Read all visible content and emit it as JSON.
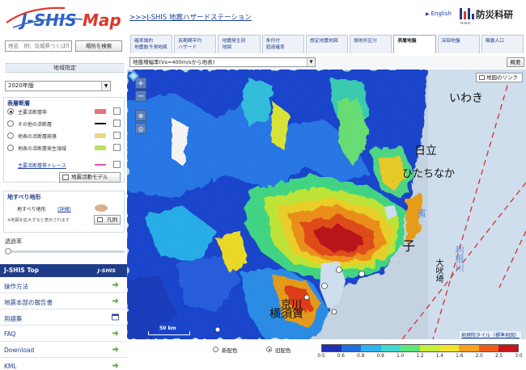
{
  "header": {
    "app_title": "J-SHIS Map",
    "top_link": ">>>J-SHIS 地震ハザードステーション",
    "lang_link": "English",
    "org_name": "防災科研",
    "org_abbr": "NIED"
  },
  "search": {
    "placeholder": "地名　例：茨城県つくば市",
    "button_label": "場所を検索"
  },
  "region": {
    "heading": "地域指定",
    "year_selected": "2020年版"
  },
  "faults": {
    "title": "表層断層",
    "rows": [
      {
        "label": "主要活断層帯",
        "color": "#e8707a",
        "selected": true
      },
      {
        "label": "その他の活断層",
        "color": "#111111",
        "selected": false
      },
      {
        "label": "地表の活断層崩落",
        "color": "#e8d98a",
        "selected": false
      },
      {
        "label": "地表の活断層発生領域",
        "color": "#b7e35c",
        "selected": false
      }
    ],
    "trace_link": "主要活断層帯トレース",
    "trace_color": "#e64fb3",
    "model_button": "地震活動モデル"
  },
  "landslide": {
    "title": "地すべり地形",
    "row_label": "地すべり地形",
    "detail_link": "(詳細)",
    "note": "※地図を拡大すると表示されます",
    "legend_button": "凡例"
  },
  "opacity": {
    "label": "透過率",
    "value_percent": 0
  },
  "top_menu": {
    "title": "J-SHIS Top",
    "mini_logo": "J-SHIS",
    "items": [
      {
        "label": "操作方法",
        "icon": "arrow-right-icon"
      },
      {
        "label": "地震本部の報告書",
        "icon": "arrow-right-icon"
      },
      {
        "label": "用語集",
        "icon": "window-icon"
      },
      {
        "label": "FAQ",
        "icon": "arrow-right-icon"
      },
      {
        "label": "Download",
        "icon": "arrow-right-icon"
      },
      {
        "label": "KML",
        "icon": "arrow-right-icon"
      }
    ]
  },
  "tabs": [
    {
      "label": "確率論的\n地震動予測地図",
      "active": false
    },
    {
      "label": "長期間平均\nハザード",
      "active": false
    },
    {
      "label": "地震発生別\n地図",
      "active": false
    },
    {
      "label": "条件付\n超過確率",
      "active": false
    },
    {
      "label": "想定地震地図",
      "active": false
    },
    {
      "label": "微地形区分",
      "active": false
    },
    {
      "label": "表層地盤",
      "active": true
    },
    {
      "label": "深部地盤",
      "active": false
    },
    {
      "label": "曝露人口",
      "active": false
    }
  ],
  "toolbar": {
    "layer_selected": "地盤増幅率(Vs=400m/sから地表)",
    "summary_button": "概要"
  },
  "map": {
    "link_button": "地図のリンク",
    "zoom_in": "+",
    "zoom_out": "−",
    "places": [
      {
        "name": "いわき",
        "type": "city"
      },
      {
        "name": "日立",
        "type": "city"
      },
      {
        "name": "ひたちなか",
        "type": "city"
      },
      {
        "name": "浦",
        "type": "water"
      },
      {
        "name": "子",
        "type": "city"
      },
      {
        "name": "利根川",
        "type": "water"
      },
      {
        "name": "大吠埼",
        "type": "city"
      },
      {
        "name": "横須賀",
        "type": "city"
      },
      {
        "name": "京川",
        "type": "city"
      }
    ],
    "scale_label": "50 km",
    "attribution": "地理院タイル（標準地図）"
  },
  "color_options": {
    "new_label": "新配色",
    "old_label": "旧配色",
    "selected": "old"
  },
  "colorbar": {
    "ticks": [
      "0.5",
      "0.6",
      "0.8",
      "0.9",
      "1.0",
      "1.2",
      "1.4",
      "1.6",
      "2.0",
      "2.5",
      "3.0"
    ],
    "colors": [
      "#1f2fb8",
      "#1f6fe0",
      "#2fb3f0",
      "#3fd9d0",
      "#5fe67a",
      "#c8ef3a",
      "#f3e62a",
      "#f7a21f",
      "#ee5a1c",
      "#c4161c"
    ]
  }
}
